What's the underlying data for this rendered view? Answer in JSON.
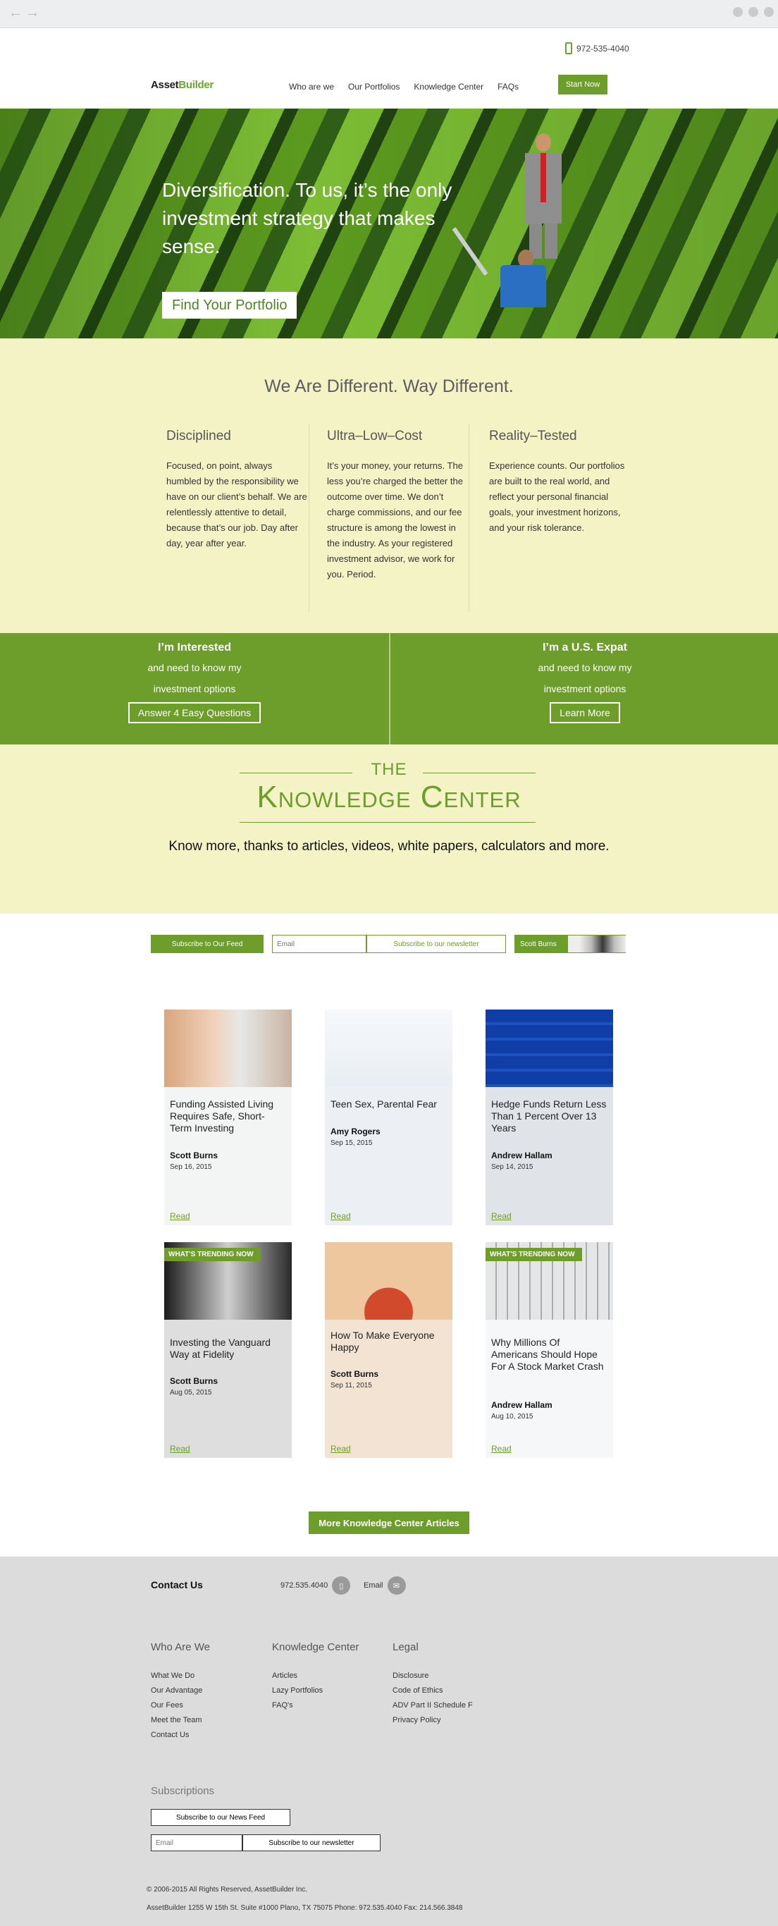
{
  "header": {
    "phone": "972-535-4040",
    "logo_part1": "Asset",
    "logo_part2": "Builder",
    "nav": [
      "Who are we",
      "Our Portfolios",
      "Knowledge Center",
      "FAQs"
    ],
    "start_button": "Start Now"
  },
  "hero": {
    "headline": "Diversification. To us, it’s the only investment strategy that makes sense.",
    "cta": "Find Your Portfolio"
  },
  "different": {
    "title": "We Are Different. Way Different.",
    "columns": [
      {
        "heading": "Disciplined",
        "body": "Focused, on point, always humbled by the responsibility we have on our client’s behalf. We are relentlessly attentive to detail, because that’s our job. Day after day, year after year."
      },
      {
        "heading": "Ultra–Low–Cost",
        "body": "It’s your money, your returns. The less you’re charged the better the outcome over time. We don’t charge commissions, and our fee structure is among the lowest in the industry. As your registered investment advisor, we work for you. Period."
      },
      {
        "heading": "Reality–Tested",
        "body": "Experience counts. Our portfolios are built to the real world, and reflect your personal financial goals, your investment horizons, and your risk tolerance."
      }
    ]
  },
  "band": {
    "left": {
      "heading": "I’m Interested",
      "text": "and need to know my investment options",
      "button": "Answer 4 Easy Questions"
    },
    "right": {
      "heading": "I’m a U.S. Expat",
      "text": "and need to know my investment options",
      "button": "Learn More"
    }
  },
  "knowledge": {
    "the": "THE",
    "title": "Knowledge Center",
    "tagline": "Know more, thanks to articles, videos, white papers, calculators and more."
  },
  "subscribe": {
    "feed_button": "Subscribe to Our Feed",
    "email_placeholder": "Email",
    "newsletter_button": "Subscribe to our newsletter",
    "author_button": "Scott Burns"
  },
  "articles": [
    {
      "title": "Funding Assisted Living Requires Safe, Short-Term Investing",
      "author": "Scott Burns",
      "date": "Sep 16, 2015",
      "read": "Read",
      "trending": ""
    },
    {
      "title": "Teen Sex, Parental Fear",
      "author": "Amy Rogers",
      "date": "Sep 15, 2015",
      "read": "Read",
      "trending": ""
    },
    {
      "title": "Hedge Funds Return Less Than 1 Percent Over 13 Years",
      "author": "Andrew Hallam",
      "date": "Sep 14, 2015",
      "read": "Read",
      "trending": ""
    },
    {
      "title": "Investing the Vanguard Way at Fidelity",
      "author": "Scott Burns",
      "date": "Aug 05, 2015",
      "read": "Read",
      "trending": "WHAT'S TRENDING NOW"
    },
    {
      "title": "How To Make Everyone Happy",
      "author": "Scott Burns",
      "date": "Sep 11, 2015",
      "read": "Read",
      "trending": ""
    },
    {
      "title": "Why Millions Of Americans Should Hope For A Stock Market Crash",
      "author": "Andrew Hallam",
      "date": "Aug 10, 2015",
      "read": "Read",
      "trending": "WHAT'S TRENDING NOW"
    }
  ],
  "more_button": "More Knowledge Center Articles",
  "footer": {
    "contact": "Contact Us",
    "phone": "972.535.4040",
    "email_label": "Email",
    "columns": [
      {
        "heading": "Who Are We",
        "links": [
          "What We Do",
          "Our Advantage",
          "Our Fees",
          "Meet the Team",
          "Contact Us"
        ]
      },
      {
        "heading": "Knowledge Center",
        "links": [
          "Articles",
          "Lazy Portfolios",
          "FAQ's"
        ]
      },
      {
        "heading": "Legal",
        "links": [
          "Disclosure",
          "Code of Ethics",
          "ADV Part II Schedule F",
          "Privacy Policy"
        ]
      }
    ],
    "subscriptions": "Subscriptions",
    "news_feed_button": "Subscribe to our News Feed",
    "email_placeholder": "Email",
    "newsletter_button": "Subscribe to our newsletter",
    "copyright": "© 2006-2015 All Rights Reserved, AssetBuilder Inc.",
    "address": "AssetBuilder 1255 W 15th St. Suite #1000 Plano, TX 75075 Phone: 972.535.4040 Fax: 214.566.3848"
  }
}
